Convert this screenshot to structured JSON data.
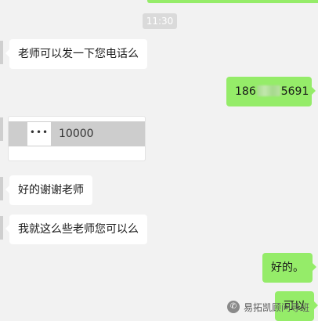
{
  "chat": {
    "timestamp": "11:30",
    "messages": [
      {
        "side": "in",
        "text": "老师可以发一下您电话么"
      },
      {
        "side": "out",
        "phone_prefix": "186",
        "phone_suffix": "5691"
      },
      {
        "side": "in",
        "kind": "card",
        "thumb_glyph": "•••",
        "value": "10000"
      },
      {
        "side": "in",
        "text": "好的谢谢老师"
      },
      {
        "side": "in",
        "text": "我就这么些老师您可以么"
      },
      {
        "side": "out",
        "text": "好的。"
      },
      {
        "side": "out",
        "text": "可以"
      }
    ]
  },
  "watermark": {
    "text": "易拓凯顾问导班",
    "icon": "wechat-icon"
  },
  "colors": {
    "background": "#f2f2f2",
    "outgoing": "#95ec69",
    "incoming": "#ffffff",
    "time_badge": "#dadada"
  }
}
